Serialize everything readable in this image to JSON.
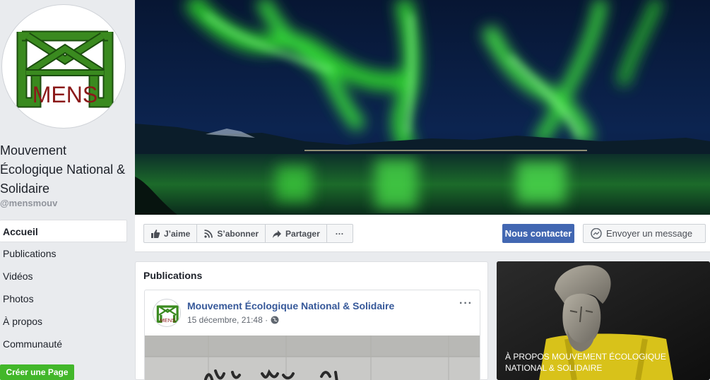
{
  "page": {
    "name": "Mouvement Écologique National & Solidaire",
    "handle": "@mensmouv",
    "logo_text": "MENS"
  },
  "nav": {
    "items": [
      {
        "label": "Accueil",
        "active": true
      },
      {
        "label": "Publications"
      },
      {
        "label": "Vidéos"
      },
      {
        "label": "Photos"
      },
      {
        "label": "À propos"
      },
      {
        "label": "Communauté"
      }
    ],
    "create_page": "Créer une Page"
  },
  "actions": {
    "like": "J’aime",
    "subscribe": "S’abonner",
    "share": "Partager",
    "more": "···",
    "contact": "Nous contacter",
    "message": "Envoyer un message"
  },
  "publications": {
    "title": "Publications",
    "post": {
      "author": "Mouvement Écologique National & Solidaire",
      "time": "15 décembre, 21:48 ·",
      "more": "···"
    }
  },
  "about": {
    "caption": "À PROPOS MOUVEMENT ÉCOLOGIQUE NATIONAL & SOLIDAIRE"
  },
  "colors": {
    "accent": "#4267b2",
    "create_button": "#42b72a",
    "link": "#365899",
    "logo_green": "#3a8a1f",
    "logo_red": "#8b1a1a"
  },
  "icons": {
    "like": "thumbs-up-icon",
    "subscribe": "rss-icon",
    "share": "share-arrow-icon",
    "message": "messenger-icon",
    "globe": "globe-icon"
  }
}
